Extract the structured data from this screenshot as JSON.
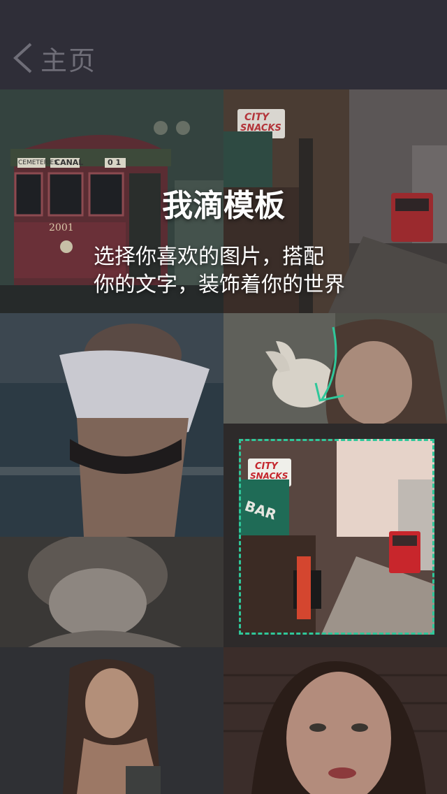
{
  "header": {
    "back_label": "主页",
    "back_icon": "chevron-left-icon"
  },
  "hero": {
    "title": "我滴模板",
    "description_line1": "选择你喜欢的图片，搭配",
    "description_line2": "你的文字，装饰着你的世界"
  },
  "tiles": {
    "streetcar_sign_route": "CANAL",
    "streetcar_sign_left": "CEMETERIES",
    "streetcar_number": "2001",
    "streetcar_sign_right": "0 1",
    "shop_sign_line1": "CITY",
    "shop_sign_line2": "SNACKS",
    "awning_text": "BAR"
  },
  "colors": {
    "accent": "#2fc79a",
    "topbar": "#2f2e38",
    "back_label": "#6f6e78"
  }
}
